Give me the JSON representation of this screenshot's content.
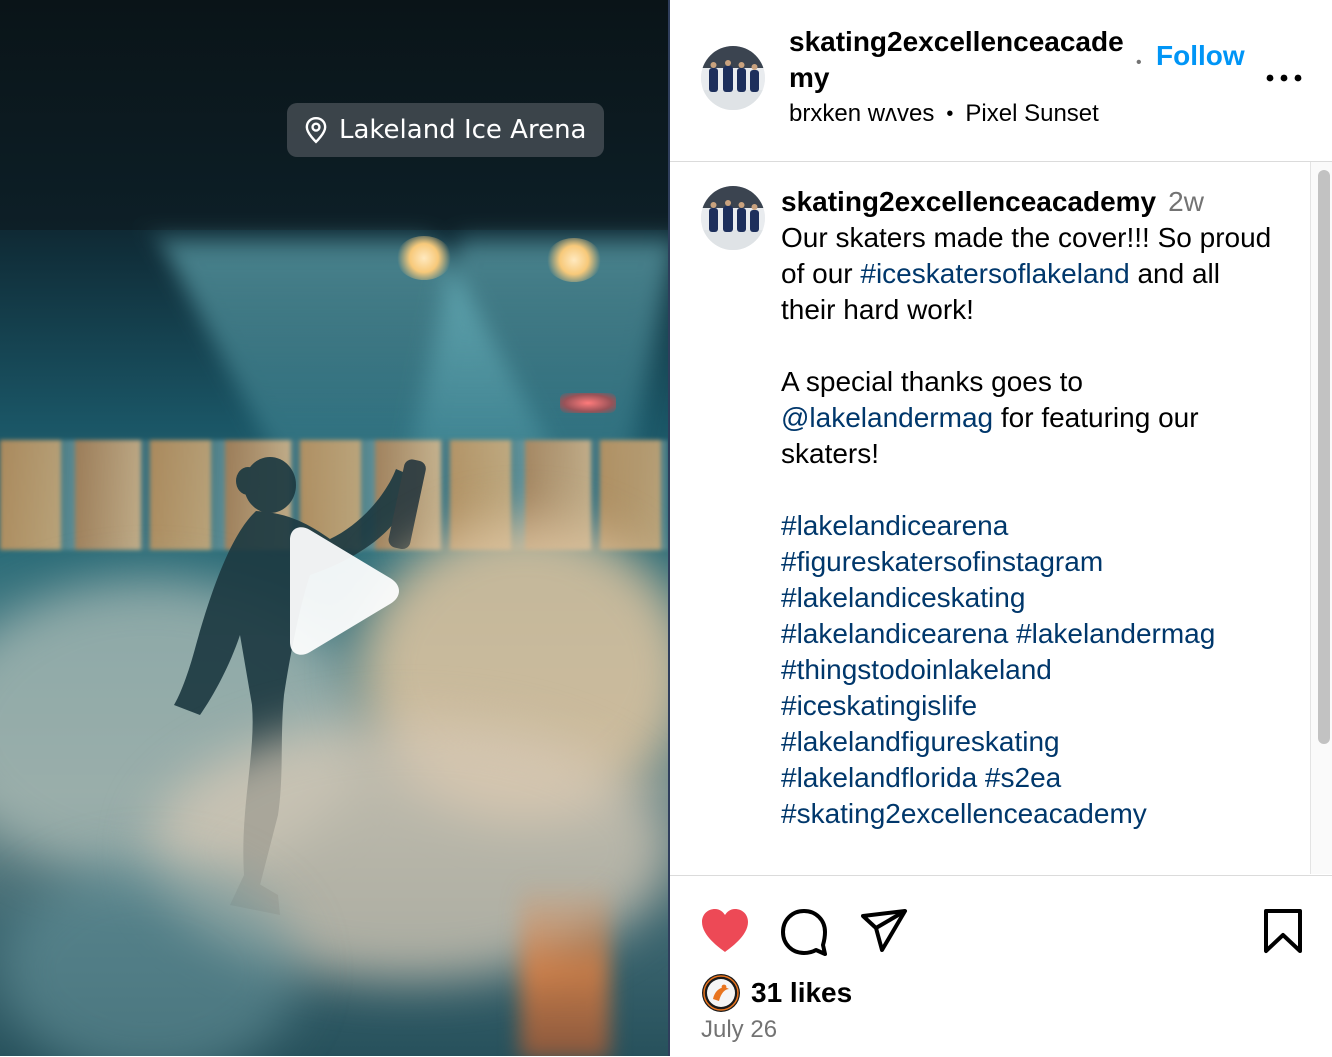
{
  "media": {
    "location_label": "Lakeland Ice Arena",
    "play_icon": "play-icon",
    "location_icon": "map-pin-icon"
  },
  "header": {
    "username": "skating2excellenceacademy",
    "follow_label": "Follow",
    "audio_artist": "brxken wʌves",
    "audio_track": "Pixel Sunset",
    "more_icon": "more-options-icon"
  },
  "caption": {
    "username": "skating2excellenceacademy",
    "age": "2w",
    "line1_text": "Our skaters made the cover!!! So proud of our ",
    "line1_tag": "#iceskatersoflakeland",
    "line1_tail": " and all their hard work!",
    "line2_text": "A special thanks goes to ",
    "line2_mention": "@lakelandermag",
    "line2_tail": " for featuring our skaters!",
    "hashtags": [
      "#lakelandicearena",
      "#figureskatersofinstagram",
      "#lakelandiceskating",
      "#lakelandicearena",
      "#lakelandermag",
      "#thingstodoinlakeland",
      "#iceskatingislife",
      "#lakelandfigureskating",
      "#lakelandflorida",
      "#s2ea",
      "#skating2excellenceacademy"
    ]
  },
  "actions": {
    "liked": true,
    "like_color": "#ed4956",
    "likes_label": "31 likes",
    "date": "July 26",
    "icons": [
      "heart-icon",
      "comment-icon",
      "share-icon",
      "bookmark-icon"
    ]
  },
  "colors": {
    "follow": "#0095f6",
    "link": "#00376b",
    "muted": "#737373"
  }
}
